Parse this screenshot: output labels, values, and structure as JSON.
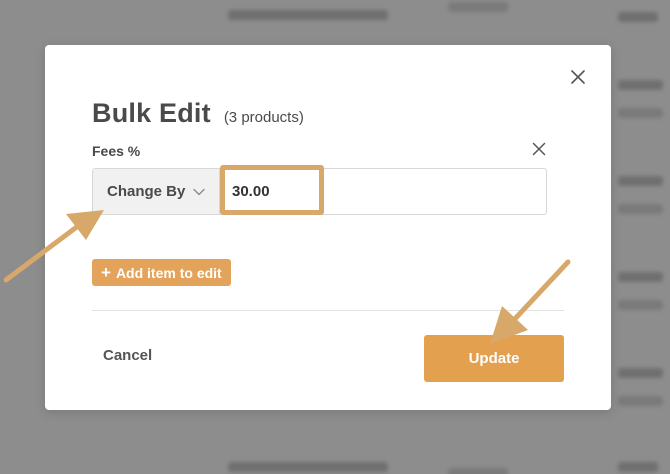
{
  "modal": {
    "title": "Bulk Edit",
    "subtitle": "(3 products)",
    "close_icon": "close-icon"
  },
  "field": {
    "label": "Fees %",
    "remove_icon": "close-icon",
    "mode": {
      "selected": "Change By",
      "icon": "chevron-down-icon"
    },
    "value": "30.00"
  },
  "add_item": {
    "icon": "plus-icon",
    "label": "Add item to edit"
  },
  "footer": {
    "cancel_label": "Cancel",
    "update_label": "Update"
  },
  "colors": {
    "accent": "#e3a04f",
    "annotation": "#d8a86a",
    "text": "#4a4a4a"
  }
}
